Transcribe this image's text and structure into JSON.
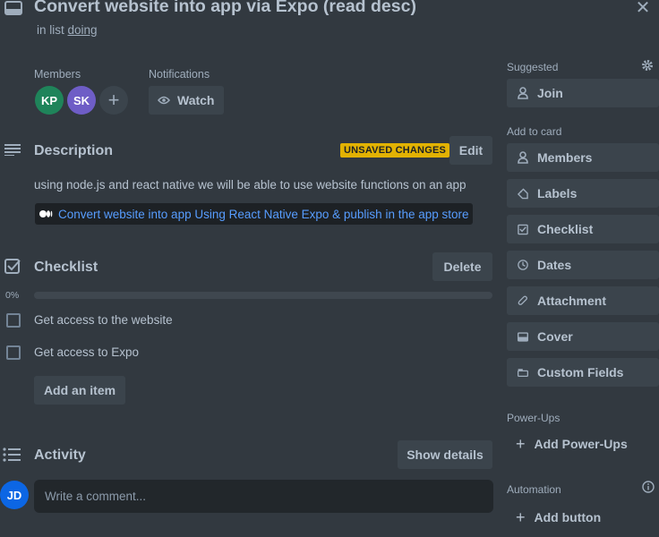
{
  "card": {
    "title": "Convert website into app via Expo (read desc)",
    "in_list_prefix": "in list",
    "list_name": "doing",
    "close_glyph": "✕"
  },
  "members": {
    "label": "Members",
    "avatars": [
      {
        "initials": "KP",
        "color": "#1f845a"
      },
      {
        "initials": "SK",
        "color": "#6e5dc6"
      }
    ],
    "add_glyph": "+"
  },
  "notifications": {
    "label": "Notifications",
    "watch_label": "Watch"
  },
  "description": {
    "title": "Description",
    "unsaved_badge": "UNSAVED CHANGES",
    "edit_label": "Edit",
    "text": "using node.js and react native we will be able to use website functions on an app",
    "link_text": "Convert website into app Using React Native Expo & publish in the app store"
  },
  "checklist": {
    "title": "Checklist",
    "delete_label": "Delete",
    "percent_text": "0%",
    "progress": 0,
    "items": [
      {
        "text": "Get access to the website",
        "checked": false
      },
      {
        "text": "Get access to Expo",
        "checked": false
      }
    ],
    "add_item_label": "Add an item"
  },
  "activity": {
    "title": "Activity",
    "show_details_label": "Show details",
    "avatar_initials": "JD",
    "avatar_color": "#0c66e4",
    "comment_placeholder": "Write a comment..."
  },
  "sidebar": {
    "suggested_label": "Suggested",
    "join_label": "Join",
    "add_to_card_label": "Add to card",
    "add_to_card": [
      {
        "label": "Members",
        "icon": "person-icon"
      },
      {
        "label": "Labels",
        "icon": "tag-icon"
      },
      {
        "label": "Checklist",
        "icon": "checklist-icon"
      },
      {
        "label": "Dates",
        "icon": "clock-icon"
      },
      {
        "label": "Attachment",
        "icon": "paperclip-icon"
      },
      {
        "label": "Cover",
        "icon": "cover-icon"
      },
      {
        "label": "Custom Fields",
        "icon": "custom-fields-icon"
      }
    ],
    "powerups_label": "Power-Ups",
    "add_powerups_label": "Add Power-Ups",
    "automation_label": "Automation",
    "add_button_label": "Add button"
  },
  "colors": {
    "background": "#323940",
    "button": "#3b444c",
    "link": "#579dff",
    "badge": "#e2b203"
  }
}
